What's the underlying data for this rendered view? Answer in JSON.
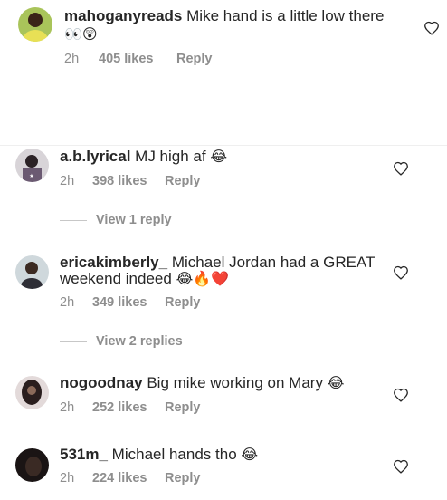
{
  "comments": [
    {
      "username": "mahoganyreads",
      "text": "Mike hand is a little low there",
      "emoji": "👀😲",
      "time": "2h",
      "likes": "405 likes",
      "reply": "Reply"
    },
    {
      "username": "a.b.lyrical",
      "text": "MJ high af",
      "emoji": "😂",
      "time": "2h",
      "likes": "398 likes",
      "reply": "Reply",
      "view_replies": "View 1 reply"
    },
    {
      "username": "ericakimberly_",
      "text": "Michael Jordan had a GREAT",
      "text2": "weekend indeed",
      "emoji": "😂🔥❤️",
      "time": "2h",
      "likes": "349 likes",
      "reply": "Reply",
      "view_replies": "View 2 replies"
    },
    {
      "username": "nogoodnay",
      "text": "Big mike working on Mary",
      "emoji": "😂",
      "time": "2h",
      "likes": "252 likes",
      "reply": "Reply"
    },
    {
      "username": "531m_",
      "text": "Michael hands tho",
      "emoji": "😂",
      "time": "2h",
      "likes": "224 likes",
      "reply": "Reply"
    }
  ],
  "icons": {
    "heart": "heart-outline-icon"
  },
  "colors": {
    "text": "#262626",
    "meta": "#8e8e8e",
    "heart_stroke": "#262626"
  }
}
